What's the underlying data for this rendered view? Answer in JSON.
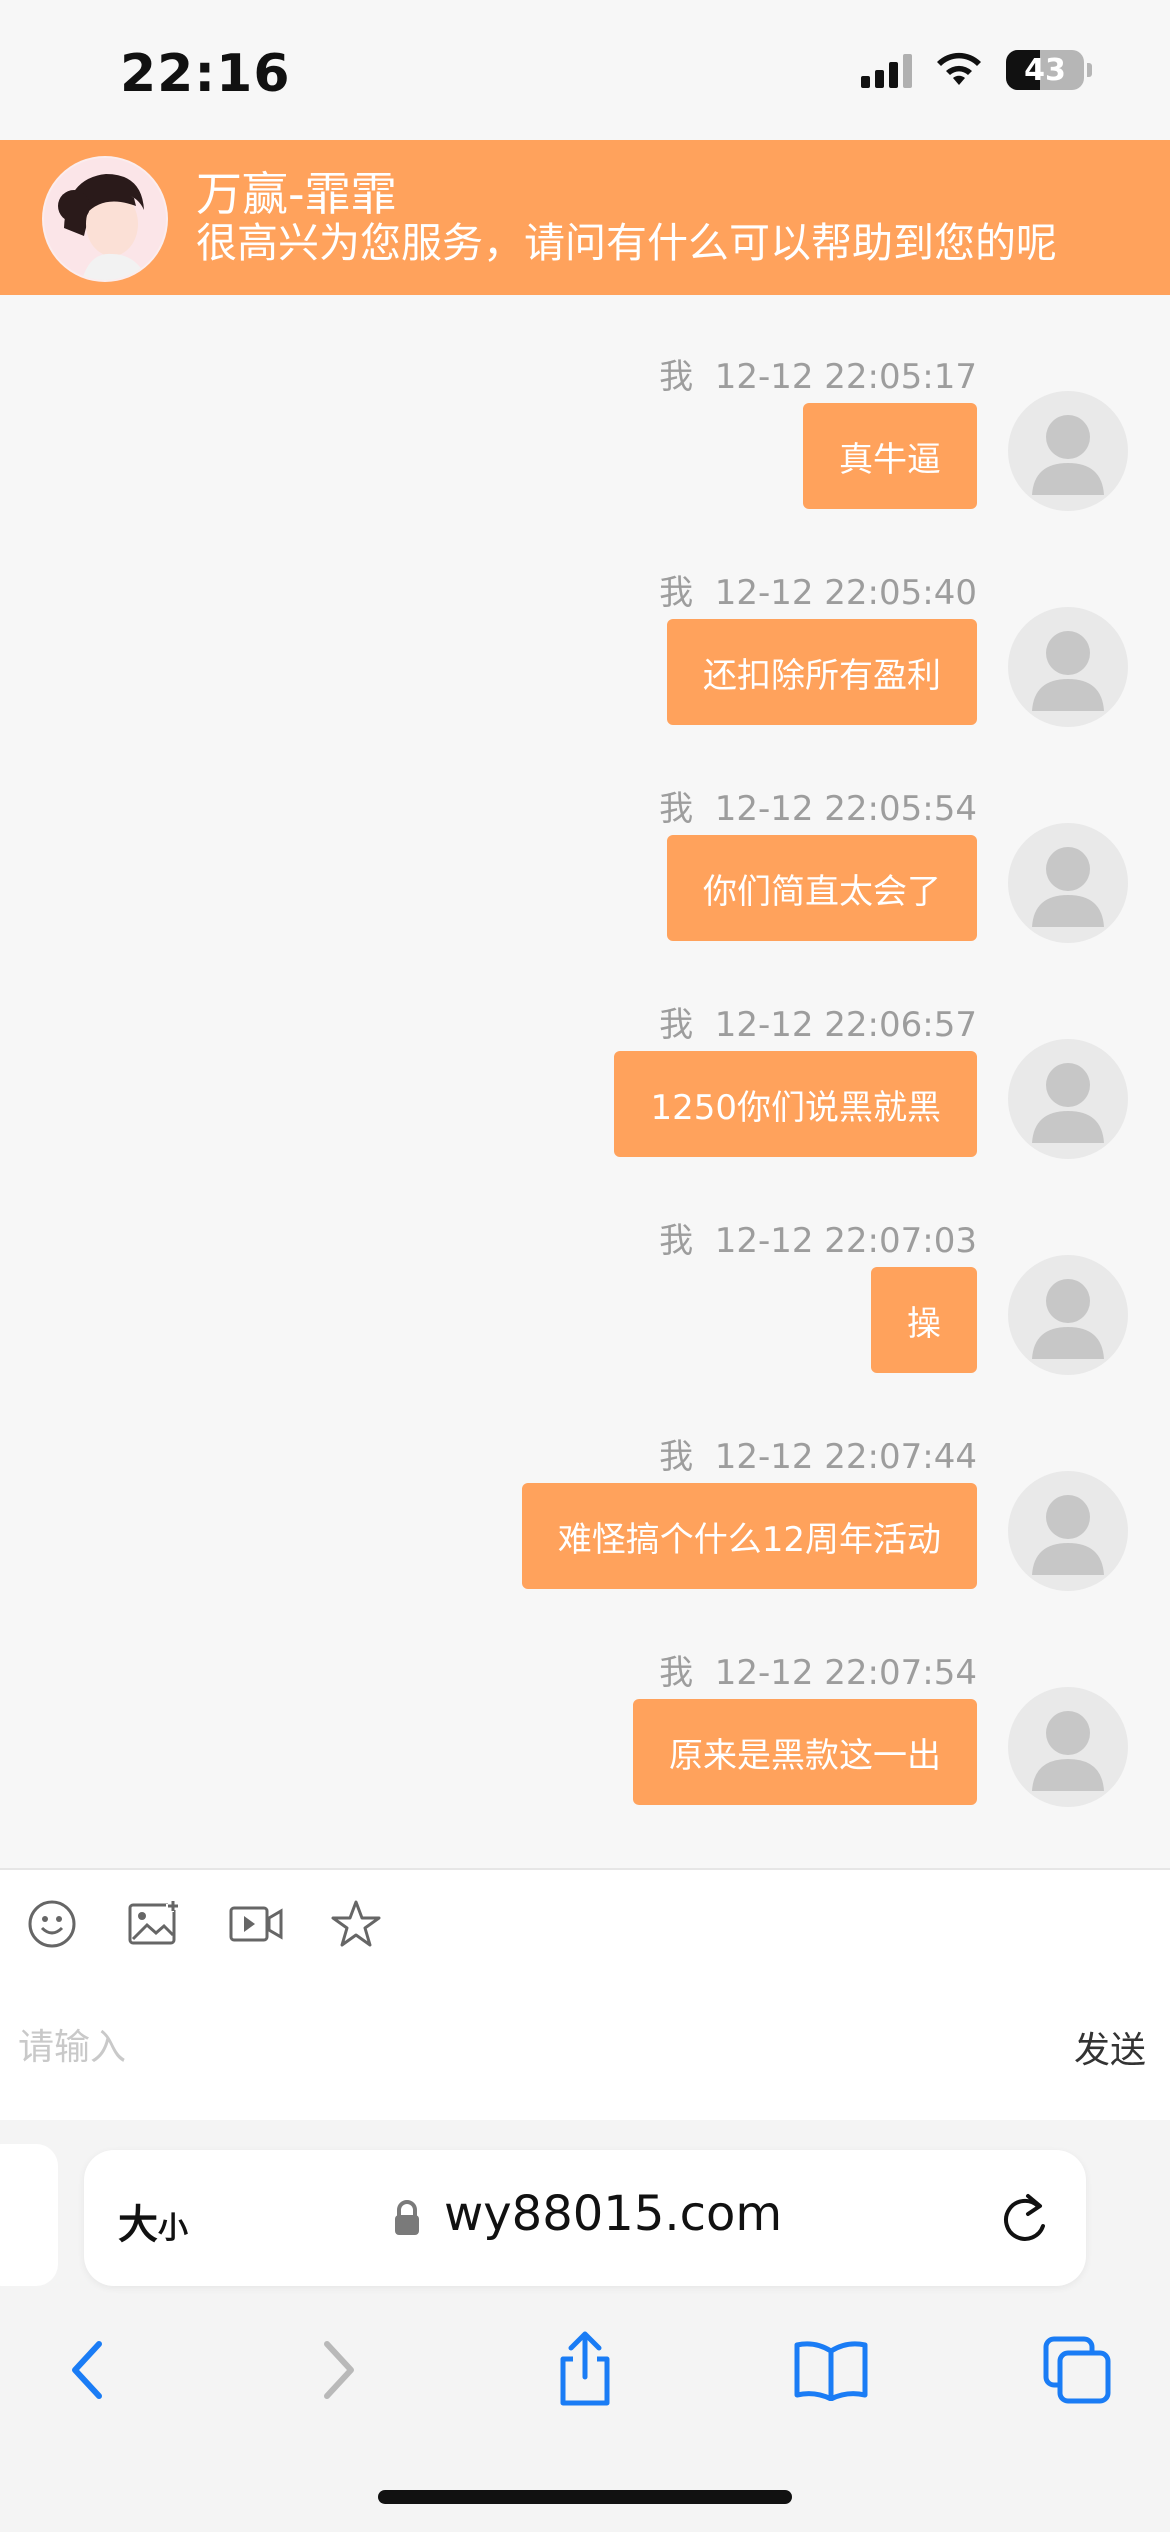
{
  "status": {
    "time": "22:16",
    "battery": "43"
  },
  "header": {
    "agent_name": "万赢-霏霏",
    "greeting": "很高兴为您服务，请问有什么可以帮助到您的呢"
  },
  "messages": [
    {
      "sender": "我",
      "time": "12-12 22:05:17",
      "text": "真牛逼"
    },
    {
      "sender": "我",
      "time": "12-12 22:05:40",
      "text": "还扣除所有盈利"
    },
    {
      "sender": "我",
      "time": "12-12 22:05:54",
      "text": "你们简直太会了"
    },
    {
      "sender": "我",
      "time": "12-12 22:06:57",
      "text": "1250你们说黑就黑"
    },
    {
      "sender": "我",
      "time": "12-12 22:07:03",
      "text": "操"
    },
    {
      "sender": "我",
      "time": "12-12 22:07:44",
      "text": "难怪搞个什么12周年活动"
    },
    {
      "sender": "我",
      "time": "12-12 22:07:54",
      "text": "原来是黑款这一出"
    }
  ],
  "toolbar": {
    "icons": [
      "emoji-icon",
      "image-icon",
      "video-icon",
      "star-icon"
    ]
  },
  "input": {
    "placeholder": "请输入",
    "send_label": "发送"
  },
  "browser": {
    "text_size_label": "大",
    "text_size_small": "小",
    "url": "wy88015.com"
  },
  "colors": {
    "accent": "#ffa25c",
    "nav_blue": "#1a7cf5"
  }
}
